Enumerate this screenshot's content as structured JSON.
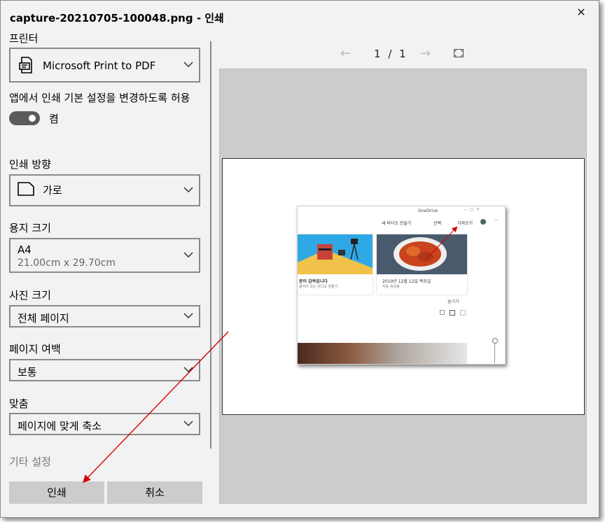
{
  "window": {
    "title": "capture-20210705-100048.png - 인쇄",
    "close_symbol": "✕"
  },
  "printer": {
    "label": "프린터",
    "value": "Microsoft Print to PDF"
  },
  "app_settings": {
    "label": "앱에서 인쇄 기본 설정을 변경하도록 허용",
    "toggle_state": "켬",
    "toggle_on": true
  },
  "orientation": {
    "label": "인쇄 방향",
    "value": "가로"
  },
  "paper_size": {
    "label": "용지 크기",
    "value": "A4",
    "detail": "21.00cm x 29.70cm"
  },
  "photo_size": {
    "label": "사진 크기",
    "value": "전체 페이지"
  },
  "margins": {
    "label": "페이지 여백",
    "value": "보통"
  },
  "fit": {
    "label": "맞춤",
    "value": "페이지에 맞게 축소"
  },
  "more_settings": "기타 설정",
  "buttons": {
    "print": "인쇄",
    "cancel": "취소"
  },
  "preview": {
    "prev_arrow": "←",
    "next_arrow": "→",
    "page_current": "1",
    "page_sep": "/",
    "page_total": "1",
    "thumbnail": {
      "app_name": "OneDrive",
      "toolbar_new_video": "새 비디오 만들기",
      "toolbar_select": "선택",
      "toolbar_import": "가져오기",
      "toolbar_more": "···",
      "card1_title": "분이 감독입니다",
      "card1_sub": "음악이 있는 비디오 만들기",
      "card2_title": "2019년 12월 12일 목요일",
      "card2_sub": "자동 생성됨",
      "hide_link": "숨기기"
    }
  },
  "colors": {
    "dialog_bg": "#f2f2f2",
    "preview_bg": "#cccccc",
    "button_bg": "#cccccc",
    "annotation_arrow": "#d40000",
    "toggle_on": "#5a5a5a"
  }
}
